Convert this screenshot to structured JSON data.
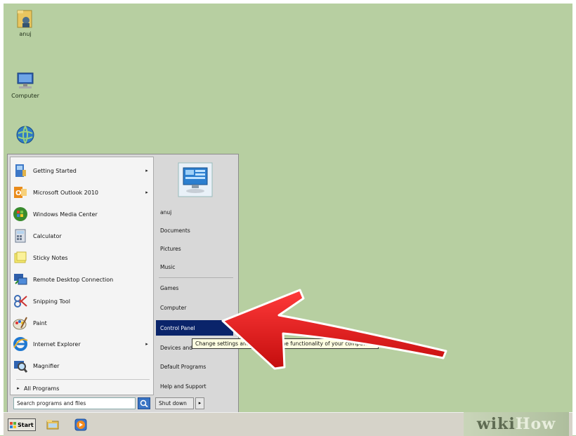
{
  "desktop": {
    "icons": [
      {
        "label": "anuj"
      },
      {
        "label": "Computer"
      },
      {
        "label": ""
      }
    ]
  },
  "start_menu": {
    "programs": [
      {
        "label": "Getting Started",
        "arrow": "▸"
      },
      {
        "label": "Microsoft Outlook 2010",
        "arrow": "▸"
      },
      {
        "label": "Windows Media Center",
        "arrow": ""
      },
      {
        "label": "Calculator",
        "arrow": ""
      },
      {
        "label": "Sticky Notes",
        "arrow": ""
      },
      {
        "label": "Remote Desktop Connection",
        "arrow": ""
      },
      {
        "label": "Snipping Tool",
        "arrow": ""
      },
      {
        "label": "Paint",
        "arrow": ""
      },
      {
        "label": "Internet Explorer",
        "arrow": "▸"
      },
      {
        "label": "Magnifier",
        "arrow": ""
      }
    ],
    "all_programs": {
      "arrow": "▸",
      "label": "All Programs"
    },
    "search": {
      "placeholder": "Search programs and files"
    },
    "right_items": [
      {
        "label": "anuj"
      },
      {
        "label": "Documents"
      },
      {
        "label": "Pictures"
      },
      {
        "label": "Music"
      },
      {
        "label": "Games"
      },
      {
        "label": "Computer"
      },
      {
        "label": "Control Panel",
        "highlighted": true
      },
      {
        "label": "Devices and"
      },
      {
        "label": "Default Programs"
      },
      {
        "label": "Help and Support"
      }
    ],
    "shutdown": {
      "label": "Shut down",
      "arrow": "▸"
    },
    "tooltip": "Change settings and customize the functionality of your computer."
  },
  "taskbar": {
    "start_label": "Start"
  },
  "watermark": {
    "wiki": "wiki",
    "how": "How"
  },
  "colors": {
    "desktop": "#b7cfa1",
    "highlight": "#0a246a",
    "arrow": "#e11b1b"
  }
}
